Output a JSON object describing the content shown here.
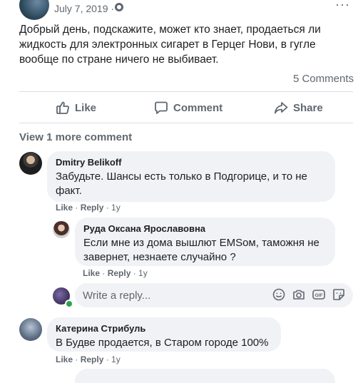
{
  "post": {
    "date": "July 7, 2019 ·",
    "text": "Добрый день, подскажите, может кто знает, продаеться ли жидкость для электронных сигарет в Герцег Нови, в гугле вообще по стране ничего не выбивает.",
    "comments_count": "5 Comments"
  },
  "actions": {
    "like": "Like",
    "comment": "Comment",
    "share": "Share"
  },
  "view_more": "View 1 more comment",
  "comments": [
    {
      "author": "Dmitry Belikoff",
      "text": "Забудьте. Шансы есть только в Подгорице, и то не факт.",
      "like": "Like",
      "reply": "Reply",
      "age": "1y"
    },
    {
      "author": "Руда Оксана Ярославовна",
      "text": "Если мне из дома вышлют EMSом, таможня не завернет, незнаете случайно ?",
      "like": "Like",
      "reply": "Reply",
      "age": "1y"
    },
    {
      "author": "Катерина Стрибуль",
      "text": "В Будве продается, в Старом городе 100%",
      "like": "Like",
      "reply": "Reply",
      "age": "1y"
    }
  ],
  "reply_input": {
    "placeholder": "Write a reply..."
  },
  "icons": [
    "globe-icon",
    "more-icon",
    "like-icon",
    "comment-icon",
    "share-icon",
    "emoji-icon",
    "camera-icon",
    "gif-icon",
    "sticker-icon"
  ],
  "colors": {
    "text": "#1c1e21",
    "secondary": "#606770",
    "bubble": "#f0f2f5",
    "online": "#31a24c"
  }
}
